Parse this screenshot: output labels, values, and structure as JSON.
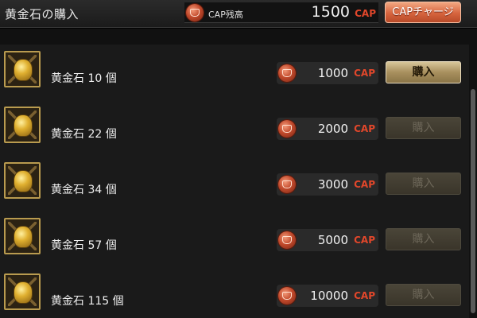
{
  "header": {
    "title": "黄金石の購入",
    "balance_label": "CAP残高",
    "balance_value": "1500",
    "balance_unit": "CAP",
    "charge_button_label": "CAPチャージ"
  },
  "items": [
    {
      "name": "黄金石 10 個",
      "price": "1000",
      "unit": "CAP",
      "buy_label": "購入",
      "enabled": true
    },
    {
      "name": "黄金石 22 個",
      "price": "2000",
      "unit": "CAP",
      "buy_label": "購入",
      "enabled": false
    },
    {
      "name": "黄金石 34 個",
      "price": "3000",
      "unit": "CAP",
      "buy_label": "購入",
      "enabled": false
    },
    {
      "name": "黄金石 57 個",
      "price": "5000",
      "unit": "CAP",
      "buy_label": "購入",
      "enabled": false
    },
    {
      "name": "黄金石 115 個",
      "price": "10000",
      "unit": "CAP",
      "buy_label": "購入",
      "enabled": false
    }
  ],
  "icons": {
    "coin": "cap-coin-icon",
    "item": "gold-stone-icon"
  },
  "colors": {
    "accent": "#e2472b",
    "charge_button": "#d6643e",
    "buy_enabled": "#a8905e",
    "buy_disabled": "#3a352a"
  }
}
